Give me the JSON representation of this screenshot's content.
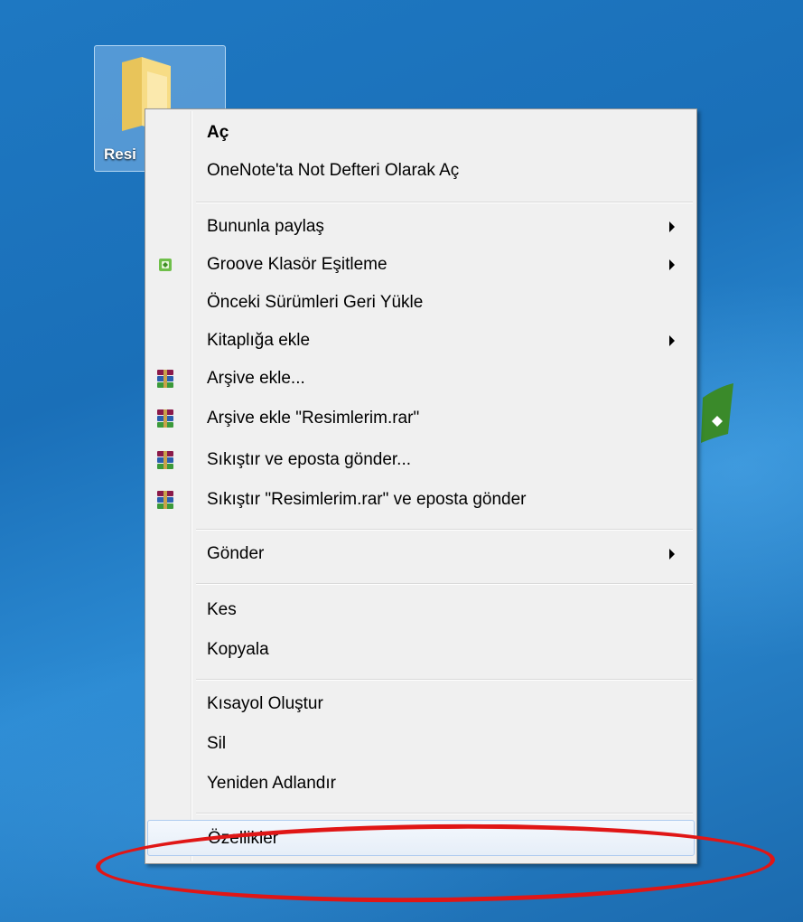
{
  "desktop": {
    "icon_label": "Resi"
  },
  "context_menu": {
    "items": [
      {
        "label": "Aç",
        "bold": true
      },
      {
        "label": "OneNote'ta Not Defteri Olarak Aç"
      },
      {
        "label": "Bununla paylaş",
        "submenu": true
      },
      {
        "label": "Groove Klasör Eşitleme",
        "submenu": true,
        "icon": "groove-icon"
      },
      {
        "label": "Önceki Sürümleri Geri Yükle"
      },
      {
        "label": "Kitaplığa ekle",
        "submenu": true
      },
      {
        "label": "Arşive ekle...",
        "icon": "winrar-icon"
      },
      {
        "label": "Arşive ekle \"Resimlerim.rar\"",
        "icon": "winrar-icon"
      },
      {
        "label": "Sıkıştır ve eposta gönder...",
        "icon": "winrar-icon"
      },
      {
        "label": "Sıkıştır \"Resimlerim.rar\" ve eposta gönder",
        "icon": "winrar-icon"
      },
      {
        "label": "Gönder",
        "submenu": true
      },
      {
        "label": "Kes"
      },
      {
        "label": "Kopyala"
      },
      {
        "label": "Kısayol Oluştur"
      },
      {
        "label": "Sil"
      },
      {
        "label": "Yeniden Adlandır"
      },
      {
        "label": "Özellikler",
        "highlighted": true
      }
    ]
  },
  "colors": {
    "annotation": "#e01616",
    "highlight_border": "#aecbef"
  }
}
